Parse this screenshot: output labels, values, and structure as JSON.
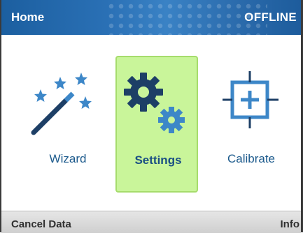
{
  "header": {
    "title": "Home",
    "status": "OFFLINE"
  },
  "tiles": [
    {
      "label": "Wizard",
      "icon": "magic-wand-icon",
      "selected": false
    },
    {
      "label": "Settings",
      "icon": "gears-icon",
      "selected": true
    },
    {
      "label": "Calibrate",
      "icon": "crosshair-icon",
      "selected": false
    }
  ],
  "footer": {
    "left_softkey": "Cancel Data",
    "right_softkey": "Info"
  },
  "colors": {
    "header_blue": "#2a70b5",
    "selected_tile": "#c9f59a",
    "icon_dark": "#1d3f66",
    "icon_light": "#3d87c8"
  }
}
